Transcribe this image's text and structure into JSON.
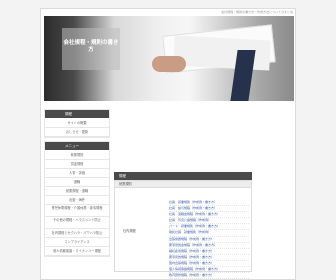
{
  "topbar": {
    "text": "会社規程・規則の書き方・作成方法についてのまとめ"
  },
  "hero": {
    "title": "会社規程・規則の書き方"
  },
  "sidebar": {
    "group1": {
      "title": "規程",
      "items": [
        {
          "label": "サイトの概要"
        },
        {
          "label": "おしらせ・更新"
        }
      ]
    },
    "group2": {
      "title": "メニュー",
      "items": [
        {
          "label": "就業規則"
        },
        {
          "label": "賃金規程"
        },
        {
          "label": "人事・評価"
        },
        {
          "label": "退職"
        },
        {
          "label": "就業規程・退職"
        },
        {
          "label": "出張・海外"
        },
        {
          "label": "育児休業規程・介護休業・慶弔規程"
        },
        {
          "label": "その他の規程・ハラスメント防止"
        },
        {
          "label": "社内規程とセクハラ・パワハラ防止"
        },
        {
          "label": "コンプライアンス"
        },
        {
          "label": "個人情報保護・マイナンバー規程"
        }
      ]
    }
  },
  "main": {
    "title": "規程",
    "subtitle": "就業規則",
    "left_label": "社内規程",
    "links": [
      "社員　就業規則（作成例・書き方）",
      "社員　給与規程（作成例・書き方）",
      "社員　退職金規程（作成例・書き方）",
      "社員　育児介護規程（作成例）",
      "パート　就業規則（作成例・書き方）",
      "嘱託社員　就業規則（作成例）",
      "出張旅費規程（作成例・書き方）",
      "慶弔見舞金規程（作成例・書き方）",
      "継続雇用規程（作成例・書き方）",
      "慶弔見舞規程（作成例・書き方）",
      "国内出張規程（作成例・書き方）",
      "個人情報保護規程（作成例・書き方）",
      "教育研修規程（作成例・書き方）"
    ]
  }
}
